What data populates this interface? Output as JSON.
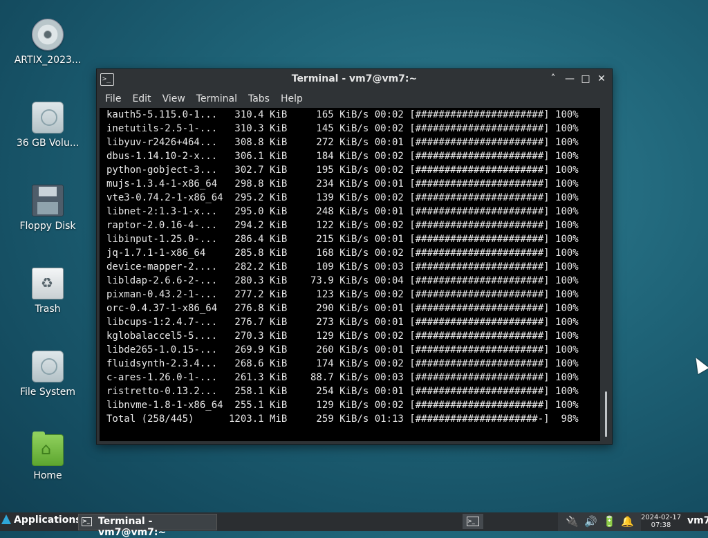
{
  "desktop": {
    "icons": [
      {
        "label": "ARTIX_2023...",
        "icon": "optical-disc-icon"
      },
      {
        "label": "36 GB Volu...",
        "icon": "hard-drive-icon"
      },
      {
        "label": "Floppy Disk",
        "icon": "floppy-disk-icon"
      },
      {
        "label": "Trash",
        "icon": "trash-icon"
      },
      {
        "label": "File System",
        "icon": "hard-drive-icon"
      },
      {
        "label": "Home",
        "icon": "home-folder-icon"
      }
    ]
  },
  "window": {
    "title": "Terminal - vm7@vm7:~",
    "menu": [
      "File",
      "Edit",
      "View",
      "Terminal",
      "Tabs",
      "Help"
    ],
    "controls": {
      "shade": "˄",
      "minimize": "—",
      "maximize": "□",
      "close": "✕"
    }
  },
  "terminal": {
    "rows": [
      {
        "name": "kauth5-5.115.0-1...",
        "size": "310.4 KiB",
        "speed": "165 KiB/s",
        "time": "00:02",
        "bar": "[######################]",
        "pct": "100%"
      },
      {
        "name": "inetutils-2.5-1-...",
        "size": "310.3 KiB",
        "speed": "145 KiB/s",
        "time": "00:02",
        "bar": "[######################]",
        "pct": "100%"
      },
      {
        "name": "libyuv-r2426+464...",
        "size": "308.8 KiB",
        "speed": "272 KiB/s",
        "time": "00:01",
        "bar": "[######################]",
        "pct": "100%"
      },
      {
        "name": "dbus-1.14.10-2-x...",
        "size": "306.1 KiB",
        "speed": "184 KiB/s",
        "time": "00:02",
        "bar": "[######################]",
        "pct": "100%"
      },
      {
        "name": "python-gobject-3...",
        "size": "302.7 KiB",
        "speed": "195 KiB/s",
        "time": "00:02",
        "bar": "[######################]",
        "pct": "100%"
      },
      {
        "name": "mujs-1.3.4-1-x86_64",
        "size": "298.8 KiB",
        "speed": "234 KiB/s",
        "time": "00:01",
        "bar": "[######################]",
        "pct": "100%"
      },
      {
        "name": "vte3-0.74.2-1-x86_64",
        "size": "295.2 KiB",
        "speed": "139 KiB/s",
        "time": "00:02",
        "bar": "[######################]",
        "pct": "100%"
      },
      {
        "name": "libnet-2:1.3-1-x...",
        "size": "295.0 KiB",
        "speed": "248 KiB/s",
        "time": "00:01",
        "bar": "[######################]",
        "pct": "100%"
      },
      {
        "name": "raptor-2.0.16-4-...",
        "size": "294.2 KiB",
        "speed": "122 KiB/s",
        "time": "00:02",
        "bar": "[######################]",
        "pct": "100%"
      },
      {
        "name": "libinput-1.25.0-...",
        "size": "286.4 KiB",
        "speed": "215 KiB/s",
        "time": "00:01",
        "bar": "[######################]",
        "pct": "100%"
      },
      {
        "name": "jq-1.7.1-1-x86_64",
        "size": "285.8 KiB",
        "speed": "168 KiB/s",
        "time": "00:02",
        "bar": "[######################]",
        "pct": "100%"
      },
      {
        "name": "device-mapper-2....",
        "size": "282.2 KiB",
        "speed": "109 KiB/s",
        "time": "00:03",
        "bar": "[######################]",
        "pct": "100%"
      },
      {
        "name": "libldap-2.6.6-2-...",
        "size": "280.3 KiB",
        "speed": "73.9 KiB/s",
        "time": "00:04",
        "bar": "[######################]",
        "pct": "100%"
      },
      {
        "name": "pixman-0.43.2-1-...",
        "size": "277.2 KiB",
        "speed": "123 KiB/s",
        "time": "00:02",
        "bar": "[######################]",
        "pct": "100%"
      },
      {
        "name": "orc-0.4.37-1-x86_64",
        "size": "276.8 KiB",
        "speed": "290 KiB/s",
        "time": "00:01",
        "bar": "[######################]",
        "pct": "100%"
      },
      {
        "name": "libcups-1:2.4.7-...",
        "size": "276.7 KiB",
        "speed": "273 KiB/s",
        "time": "00:01",
        "bar": "[######################]",
        "pct": "100%"
      },
      {
        "name": "kglobalaccel5-5....",
        "size": "270.3 KiB",
        "speed": "129 KiB/s",
        "time": "00:02",
        "bar": "[######################]",
        "pct": "100%"
      },
      {
        "name": "libde265-1.0.15-...",
        "size": "269.9 KiB",
        "speed": "260 KiB/s",
        "time": "00:01",
        "bar": "[######################]",
        "pct": "100%"
      },
      {
        "name": "fluidsynth-2.3.4...",
        "size": "268.6 KiB",
        "speed": "174 KiB/s",
        "time": "00:02",
        "bar": "[######################]",
        "pct": "100%"
      },
      {
        "name": "c-ares-1.26.0-1-...",
        "size": "261.3 KiB",
        "speed": "88.7 KiB/s",
        "time": "00:03",
        "bar": "[######################]",
        "pct": "100%"
      },
      {
        "name": "ristretto-0.13.2...",
        "size": "258.1 KiB",
        "speed": "254 KiB/s",
        "time": "00:01",
        "bar": "[######################]",
        "pct": "100%"
      },
      {
        "name": "libnvme-1.8-1-x86_64",
        "size": "255.1 KiB",
        "speed": "129 KiB/s",
        "time": "00:02",
        "bar": "[######################]",
        "pct": "100%"
      },
      {
        "name": "Total (258/445)",
        "size": "1203.1 MiB",
        "speed": "259 KiB/s",
        "time": "01:13",
        "bar": "[#####################-]",
        "pct": "98%"
      }
    ]
  },
  "taskbar": {
    "applications_label": "Applications",
    "task_label": "Terminal - vm7@vm7:~",
    "date": "2024-02-17",
    "time": "07:38",
    "user": "vm7"
  }
}
